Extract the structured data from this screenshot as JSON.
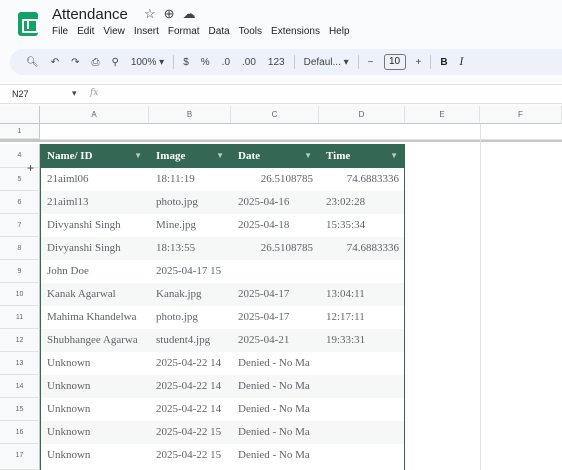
{
  "document": {
    "title": "Attendance"
  },
  "menu": [
    "File",
    "Edit",
    "View",
    "Insert",
    "Format",
    "Data",
    "Tools",
    "Extensions",
    "Help"
  ],
  "toolbar": {
    "zoom": "100%",
    "currency": "$",
    "percent": "%",
    "decrease_decimal": ".0",
    "increase_decimal": ".00",
    "number_format": "123",
    "font": "Defaul...",
    "font_size": "10",
    "minus": "−",
    "plus": "+",
    "bold": "B",
    "italic": "I"
  },
  "formula_bar": {
    "cell_ref": "N27",
    "fx": "fx"
  },
  "columns": [
    "A",
    "B",
    "C",
    "D",
    "E",
    "F"
  ],
  "rows": [
    "1",
    "4",
    "5",
    "6",
    "7",
    "8",
    "9",
    "10",
    "11",
    "12",
    "13",
    "14",
    "15",
    "16",
    "17"
  ],
  "table": {
    "headers": [
      "Name/ ID",
      "Image",
      "Date",
      "Time"
    ],
    "rows": [
      [
        "21aiml06",
        "18:11:19",
        "26.5108785",
        "74.6883336"
      ],
      [
        "21aiml13",
        "photo.jpg",
        "2025-04-16",
        "23:02:28"
      ],
      [
        "Divyanshi Singh",
        "Mine.jpg",
        "2025-04-18",
        "15:35:34"
      ],
      [
        "Divyanshi Singh",
        "18:13:55",
        "26.5108785",
        "74.6883336"
      ],
      [
        "John Doe",
        "2025-04-17 15",
        "",
        ""
      ],
      [
        "Kanak Agarwal",
        "Kanak.jpg",
        "2025-04-17",
        "13:04:11"
      ],
      [
        "Mahima Khandelwa",
        "photo.jpg",
        "2025-04-17",
        "12:17:11"
      ],
      [
        "Shubhangee Agarwa",
        "student4.jpg",
        "2025-04-21",
        "19:33:31"
      ],
      [
        "Unknown",
        "2025-04-22 14",
        "Denied - No Ma",
        ""
      ],
      [
        "Unknown",
        "2025-04-22 14",
        "Denied - No Ma",
        ""
      ],
      [
        "Unknown",
        "2025-04-22 14",
        "Denied - No Ma",
        ""
      ],
      [
        "Unknown",
        "2025-04-22 15",
        "Denied - No Ma",
        ""
      ],
      [
        "Unknown",
        "2025-04-22 15",
        "Denied - No Ma",
        ""
      ]
    ]
  },
  "colors": {
    "header_bg": "#356854",
    "header_text": "#ffffff",
    "logo": "#11a363",
    "toolbar_bg": "#edf2fa"
  }
}
